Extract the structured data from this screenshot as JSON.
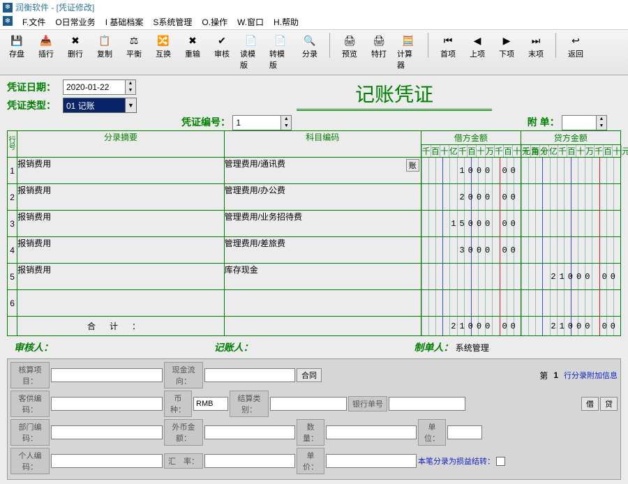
{
  "app_title": "润衡软件 - [凭证修改]",
  "menu": [
    "F.文件",
    "O日常业务",
    "I 基础档案",
    "S系统管理",
    "O.操作",
    "W.窗口",
    "H.帮助"
  ],
  "toolbar": [
    {
      "icon": "💾",
      "label": "存盘"
    },
    {
      "icon": "📥",
      "label": "插行"
    },
    {
      "icon": "✖",
      "label": "删行"
    },
    {
      "icon": "📋",
      "label": "复制"
    },
    {
      "icon": "⚖",
      "label": "平衡"
    },
    {
      "icon": "🔀",
      "label": "互换"
    },
    {
      "icon": "✖",
      "label": "重输"
    },
    {
      "icon": "✔",
      "label": "审核"
    },
    {
      "icon": "📄",
      "label": "读模版"
    },
    {
      "icon": "📄",
      "label": "转模版"
    },
    {
      "icon": "🔍",
      "label": "分录"
    },
    {
      "icon": "🖨",
      "label": "预览"
    },
    {
      "icon": "🖨",
      "label": "特打"
    },
    {
      "icon": "🧮",
      "label": "计算器"
    },
    {
      "icon": "⏮",
      "label": "首项"
    },
    {
      "icon": "◀",
      "label": "上项"
    },
    {
      "icon": "▶",
      "label": "下项"
    },
    {
      "icon": "⏭",
      "label": "末项"
    },
    {
      "icon": "↩",
      "label": "返回"
    }
  ],
  "header": {
    "date_label": "凭证日期：",
    "date_value": "2020-01-22",
    "type_label": "凭证类型：",
    "type_value": "01 记账",
    "doc_title": "记账凭证",
    "number_label": "凭证编号：",
    "number_value": "1",
    "attach_label": "附 单：",
    "attach_value": ""
  },
  "table": {
    "headers": {
      "rowno": "行号",
      "summary": "分录摘要",
      "subject": "科目编码",
      "debit": "借方金额",
      "credit": "贷方金额"
    },
    "sub_units": [
      "千",
      "百",
      "十",
      "亿",
      "千",
      "百",
      "十",
      "万",
      "千",
      "百",
      "十",
      "元",
      "角",
      "分"
    ],
    "rows": [
      {
        "no": "1",
        "summary": "报销费用",
        "subject": "管理费用/通讯费",
        "debit": "1000 00",
        "credit": "",
        "zhang": true
      },
      {
        "no": "2",
        "summary": "报销费用",
        "subject": "管理费用/办公费",
        "debit": "2000 00",
        "credit": ""
      },
      {
        "no": "3",
        "summary": "报销费用",
        "subject": "管理费用/业务招待费",
        "debit": "15000 00",
        "credit": ""
      },
      {
        "no": "4",
        "summary": "报销费用",
        "subject": "管理费用/差旅费",
        "debit": "3000 00",
        "credit": ""
      },
      {
        "no": "5",
        "summary": "报销费用",
        "subject": "库存现金",
        "debit": "",
        "credit": "21000 00"
      },
      {
        "no": "6",
        "summary": "",
        "subject": "",
        "debit": "",
        "credit": ""
      }
    ],
    "total_label": "合计：",
    "total_debit": "21000 00",
    "total_credit": "21000 00"
  },
  "signs": {
    "audit": "审核人：",
    "book": "记账人：",
    "make": "制单人：",
    "maker": "系统管理"
  },
  "bottom": {
    "row1": {
      "proj": "核算项目：",
      "cash": "现金流向：",
      "contract": "合同",
      "page_prefix": "第",
      "page_no": "1",
      "extra": "行分录附加信息"
    },
    "row2": {
      "vendor": "客供编码：",
      "currency": "币种：",
      "currency_val": "RMB",
      "settle": "结算类别：",
      "bank": "银行单号",
      "debit_btn": "借",
      "credit_btn": "贷"
    },
    "row3": {
      "dept": "部门编码：",
      "foreign": "外币金额：",
      "qty": "数量：",
      "unit": "单位："
    },
    "row4": {
      "person": "个人编码：",
      "rate": "汇　率：",
      "price": "单价：",
      "carry": "本笔分录为损益结转："
    }
  }
}
